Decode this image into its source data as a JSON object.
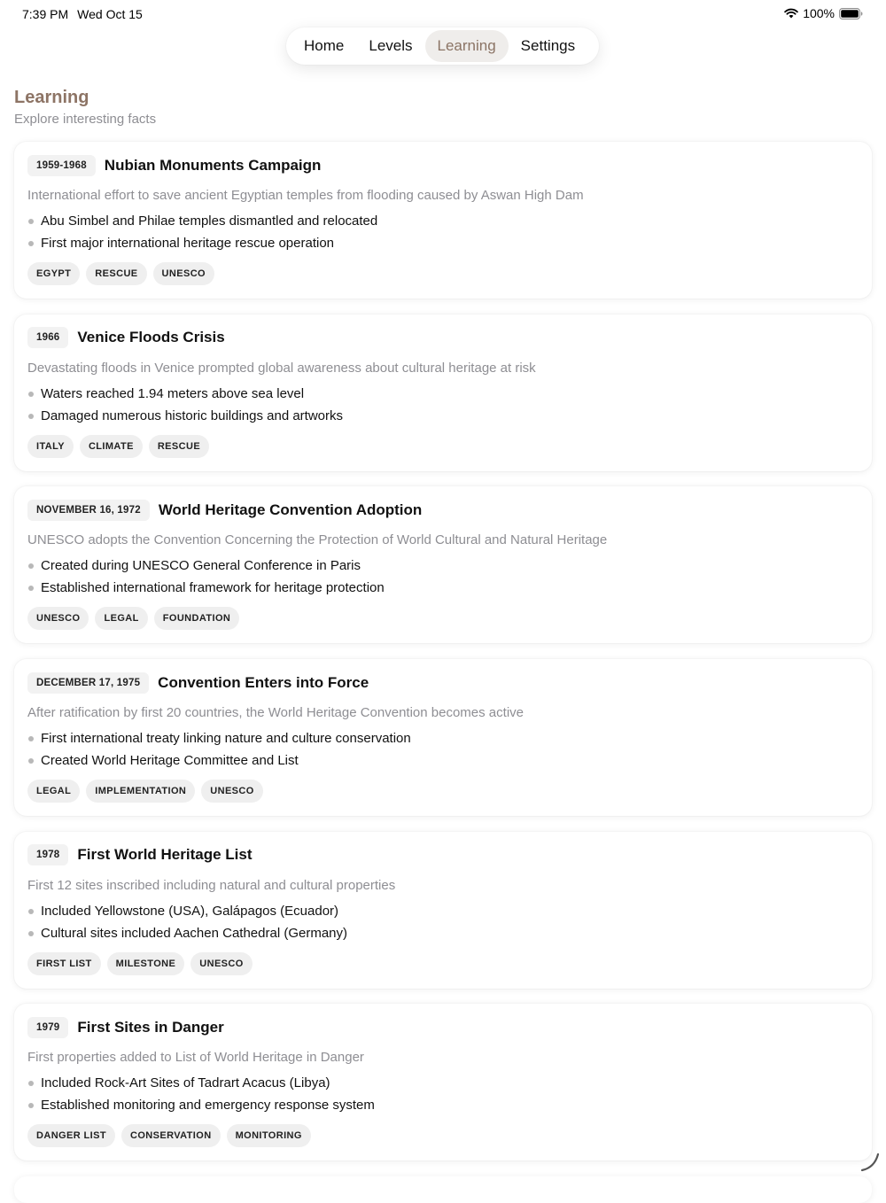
{
  "status_bar": {
    "time": "7:39 PM",
    "date": "Wed Oct 15",
    "battery": "100%",
    "icons": [
      "wifi-icon",
      "battery-icon"
    ]
  },
  "nav": {
    "tabs": [
      {
        "label": "Home",
        "active": false
      },
      {
        "label": "Levels",
        "active": false
      },
      {
        "label": "Learning",
        "active": true
      },
      {
        "label": "Settings",
        "active": false
      }
    ]
  },
  "page": {
    "title": "Learning",
    "subtitle": "Explore interesting facts"
  },
  "colors": {
    "accent": "#8d7465",
    "muted_text": "#8e8e93",
    "chip_bg": "#f2f2f2"
  },
  "cards": [
    {
      "date": "1959-1968",
      "title": "Nubian Monuments Campaign",
      "description": "International effort to save ancient Egyptian temples from flooding caused by Aswan High Dam",
      "bullets": [
        "Abu Simbel and Philae temples dismantled and relocated",
        "First major international heritage rescue operation"
      ],
      "tags": [
        "EGYPT",
        "RESCUE",
        "UNESCO"
      ]
    },
    {
      "date": "1966",
      "title": "Venice Floods Crisis",
      "description": "Devastating floods in Venice prompted global awareness about cultural heritage at risk",
      "bullets": [
        "Waters reached 1.94 meters above sea level",
        "Damaged numerous historic buildings and artworks"
      ],
      "tags": [
        "ITALY",
        "CLIMATE",
        "RESCUE"
      ]
    },
    {
      "date": "NOVEMBER 16, 1972",
      "title": "World Heritage Convention Adoption",
      "description": "UNESCO adopts the Convention Concerning the Protection of World Cultural and Natural Heritage",
      "bullets": [
        "Created during UNESCO General Conference in Paris",
        "Established international framework for heritage protection"
      ],
      "tags": [
        "UNESCO",
        "LEGAL",
        "FOUNDATION"
      ]
    },
    {
      "date": "DECEMBER 17, 1975",
      "title": "Convention Enters into Force",
      "description": "After ratification by first 20 countries, the World Heritage Convention becomes active",
      "bullets": [
        "First international treaty linking nature and culture conservation",
        "Created World Heritage Committee and List"
      ],
      "tags": [
        "LEGAL",
        "IMPLEMENTATION",
        "UNESCO"
      ]
    },
    {
      "date": "1978",
      "title": "First World Heritage List",
      "description": "First 12 sites inscribed including natural and cultural properties",
      "bullets": [
        "Included Yellowstone (USA), Galápagos (Ecuador)",
        "Cultural sites included Aachen Cathedral (Germany)"
      ],
      "tags": [
        "FIRST LIST",
        "MILESTONE",
        "UNESCO"
      ]
    },
    {
      "date": "1979",
      "title": "First Sites in Danger",
      "description": "First properties added to List of World Heritage in Danger",
      "bullets": [
        "Included Rock-Art Sites of Tadrart Acacus (Libya)",
        "Established monitoring and emergency response system"
      ],
      "tags": [
        "DANGER LIST",
        "CONSERVATION",
        "MONITORING"
      ]
    }
  ]
}
